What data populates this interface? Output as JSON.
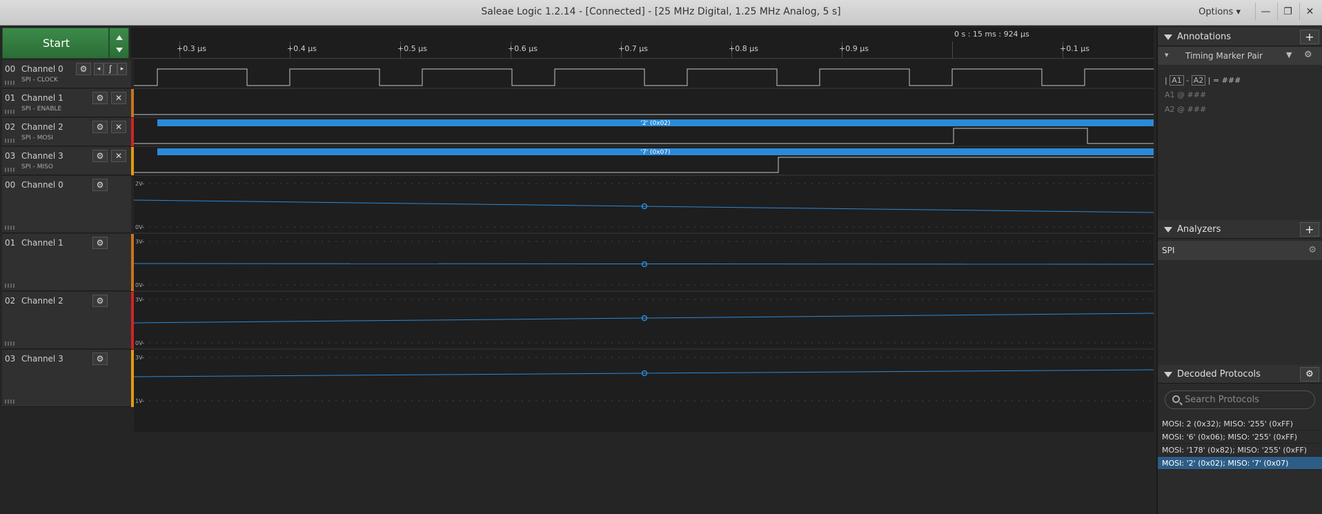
{
  "window": {
    "title": "Saleae Logic 1.2.14 - [Connected] - [25 MHz Digital, 1.25 MHz Analog, 5 s]",
    "options_label": "Options",
    "minimize": "—",
    "restore": "❐",
    "close": "✕"
  },
  "start_button": {
    "label": "Start"
  },
  "timeline": {
    "timestamp": "0 s : 15 ms : 924 µs",
    "ticks": [
      "+0.3 µs",
      "+0.4 µs",
      "+0.5 µs",
      "+0.6 µs",
      "+0.7 µs",
      "+0.8 µs",
      "+0.9 µs",
      "+0.1 µs"
    ]
  },
  "digital_channels": [
    {
      "num": "00",
      "name": "Channel 0",
      "sub": "SPI - CLOCK",
      "color": "#8a8a8a"
    },
    {
      "num": "01",
      "name": "Channel 1",
      "sub": "SPI - ENABLE",
      "color": "#c9741f"
    },
    {
      "num": "02",
      "name": "Channel 2",
      "sub": "SPI - MOSI",
      "color": "#d02424"
    },
    {
      "num": "03",
      "name": "Channel 3",
      "sub": "SPI - MISO",
      "color": "#e39a13"
    }
  ],
  "analog_channels": [
    {
      "num": "00",
      "name": "Channel 0",
      "top": "2V-",
      "bottom": "0V-"
    },
    {
      "num": "01",
      "name": "Channel 1",
      "top": "3V-",
      "bottom": "0V-"
    },
    {
      "num": "02",
      "name": "Channel 2",
      "top": "3V-",
      "bottom": "0V-"
    },
    {
      "num": "03",
      "name": "Channel 3",
      "top": "3V-",
      "bottom": "1V-"
    }
  ],
  "decoded_bubbles": {
    "mosi": "'2' (0x02)",
    "miso": "'7' (0x07)"
  },
  "annotations": {
    "title": "Annotations",
    "marker_pair": "Timing Marker Pair",
    "line1": {
      "a1": "A1",
      "dash": "-",
      "a2": "A2",
      "eq": "| = ###"
    },
    "line2": {
      "label": "A1",
      "at": "@",
      "value": "###"
    },
    "line3": {
      "label": "A2",
      "at": "@",
      "value": "###"
    }
  },
  "analyzers": {
    "title": "Analyzers",
    "items": [
      "SPI"
    ]
  },
  "decoded_protocols": {
    "title": "Decoded Protocols",
    "search_placeholder": "Search Protocols",
    "rows": [
      "MOSI: 2 (0x32);  MISO: '255' (0xFF)",
      "MOSI: '6' (0x06);  MISO: '255' (0xFF)",
      "MOSI: '178' (0x82);  MISO: '255' (0xFF)",
      "MOSI: '2' (0x02);  MISO: '7' (0x07)"
    ]
  },
  "colors": {
    "accent_green": "#2f7a3c",
    "wave_blue": "#2b8ad8",
    "selection": "#2d5d86"
  }
}
